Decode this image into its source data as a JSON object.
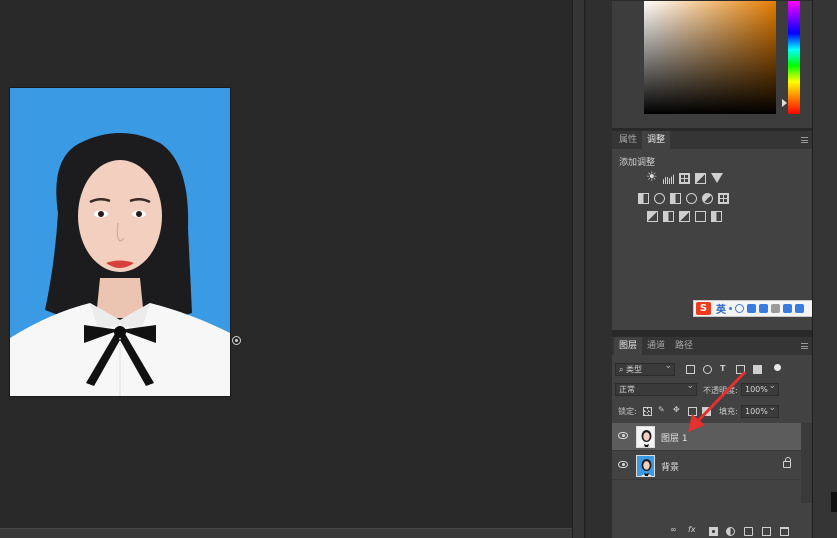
{
  "adjustments_panel": {
    "tabs": [
      "属性",
      "调整"
    ],
    "active_tab": "调整",
    "add_adjustment_label": "添加调整",
    "row1_icons": [
      "brightness-contrast-icon",
      "levels-icon",
      "curves-icon",
      "exposure-icon",
      "vibrance-icon"
    ],
    "row2_icons": [
      "hue-saturation-icon",
      "color-balance-icon",
      "black-white-icon",
      "photo-filter-icon",
      "channel-mixer-icon",
      "color-lookup-icon"
    ],
    "row3_icons": [
      "invert-icon",
      "posterize-icon",
      "threshold-icon",
      "selective-color-icon",
      "gradient-map-icon"
    ]
  },
  "ime_toolbar": {
    "logo": "S",
    "language": "英",
    "icons": [
      "punctuation-icon",
      "emoji-icon",
      "microphone-icon",
      "keyboard-icon",
      "skin-icon",
      "shirt-icon",
      "grid-icon"
    ]
  },
  "layers_panel": {
    "tabs": [
      "图层",
      "通道",
      "路径"
    ],
    "active_tab": "图层",
    "filter_kind": "类型",
    "blend_mode": "正常",
    "opacity_label": "不透明度:",
    "opacity_value": "100%",
    "lock_label": "锁定:",
    "fill_label": "填充:",
    "fill_value": "100%",
    "layers": [
      {
        "name": "图层 1",
        "selected": true,
        "visible": true,
        "locked": false
      },
      {
        "name": "背景",
        "selected": false,
        "visible": true,
        "locked": true
      }
    ],
    "footer_fx": "fx"
  },
  "colors": {
    "photo_background": "#3b9ae4",
    "selected_layer": "#5c5c5c",
    "annotation_arrow": "#e53030"
  }
}
